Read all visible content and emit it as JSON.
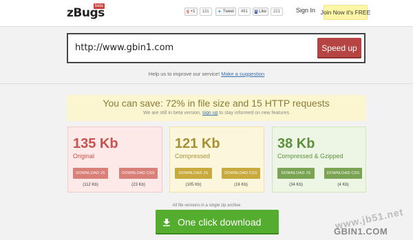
{
  "header": {
    "logo": "zBugs",
    "beta_badge": "beta",
    "social": {
      "gplus_label": "+1",
      "gplus_count": "131",
      "tweet_label": "Tweet",
      "tweet_count": "491",
      "like_label": "Like",
      "like_count": "221"
    },
    "signin_label": "Sign In",
    "join_label": "Join Now it's FREE"
  },
  "url_bar": {
    "value": "http://www.gbin1.com",
    "button_label": "Speed up"
  },
  "help": {
    "text": "Help us to improve our service!",
    "link": "Make a suggestion"
  },
  "banner": {
    "title": "You can save: 72% in file size and 15 HTTP requests",
    "sub_prefix": "We are still in beta version,",
    "sub_link": "sign up",
    "sub_suffix": "to stay informed on new features"
  },
  "cards": [
    {
      "size": "135 Kb",
      "caption": "Original",
      "js_label": "DOWNLOAD JS",
      "css_label": "DOWNLOAD CSS",
      "js_size": "(112 Kb)",
      "css_size": "(23 Kb)"
    },
    {
      "size": "121 Kb",
      "caption": "Compressed",
      "js_label": "DOWNLOAD JS",
      "css_label": "DOWNLOAD CSS",
      "js_size": "(105 Kb)",
      "css_size": "(16 Kb)"
    },
    {
      "size": "38 Kb",
      "caption": "Compressed & Gzipped",
      "js_label": "DOWNLOAD JS",
      "css_label": "DOWNLOAD CSS",
      "js_size": "(34 Kb)",
      "css_size": "(4 Kb)"
    }
  ],
  "download": {
    "note": "All file versions in a single zip archive",
    "button_label": "One click download"
  },
  "watermark": {
    "line1": "www.jb51.net",
    "line2": "GBIN1.COM"
  },
  "icons": {
    "download": "download-arrow-icon"
  },
  "colors": {
    "original": "#c9514d",
    "compressed": "#a69034",
    "gzipped": "#5e8f3c",
    "speed_button": "#b54443",
    "download_button": "#54ad2e"
  }
}
